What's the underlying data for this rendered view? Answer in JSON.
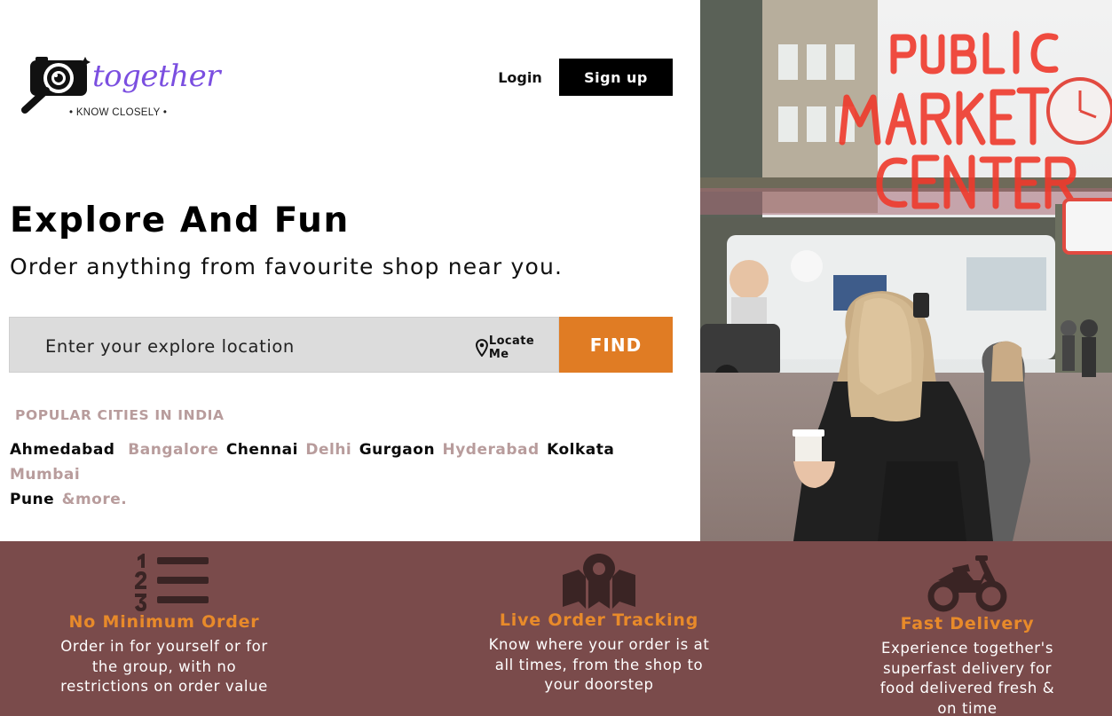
{
  "brand": {
    "name": "together",
    "tagline": "• KNOW CLOSELY •"
  },
  "nav": {
    "login_label": "Login",
    "signup_label": "Sign up"
  },
  "hero": {
    "title": "Explore And Fun",
    "subtitle": "Order anything from favourite shop near you."
  },
  "search": {
    "placeholder": "Enter your explore location",
    "locate_label": "Locate Me",
    "find_label": "FIND"
  },
  "popular": {
    "heading": "POPULAR CITIES IN INDIA",
    "cities": [
      "Ahmedabad",
      "Bangalore",
      "Chennai",
      "Delhi",
      "Gurgaon",
      "Hyderabad",
      "Kolkata",
      "Mumbai",
      "Pune",
      "&more."
    ]
  },
  "photo_sign": {
    "line1": "PUBLIC",
    "line2": "MARKET",
    "line3": "CENTER"
  },
  "features": [
    {
      "icon": "numbered-list-icon",
      "title": "No Minimum Order",
      "desc": "Order in for yourself or for the group, with no restrictions on order value"
    },
    {
      "icon": "map-pin-icon",
      "title": "Live Order Tracking",
      "desc": "Know where your order is at all times, from the shop to your doorstep"
    },
    {
      "icon": "motorcycle-icon",
      "title": "Fast Delivery",
      "desc": "Experience together's superfast delivery for food delivered fresh & on time"
    }
  ],
  "colors": {
    "accent": "#e07c24",
    "footer_bg": "#7a4b4b",
    "feature_title": "#e88a2a",
    "city_light": "#b89c9c",
    "brand_purple": "#7b4fe0"
  }
}
